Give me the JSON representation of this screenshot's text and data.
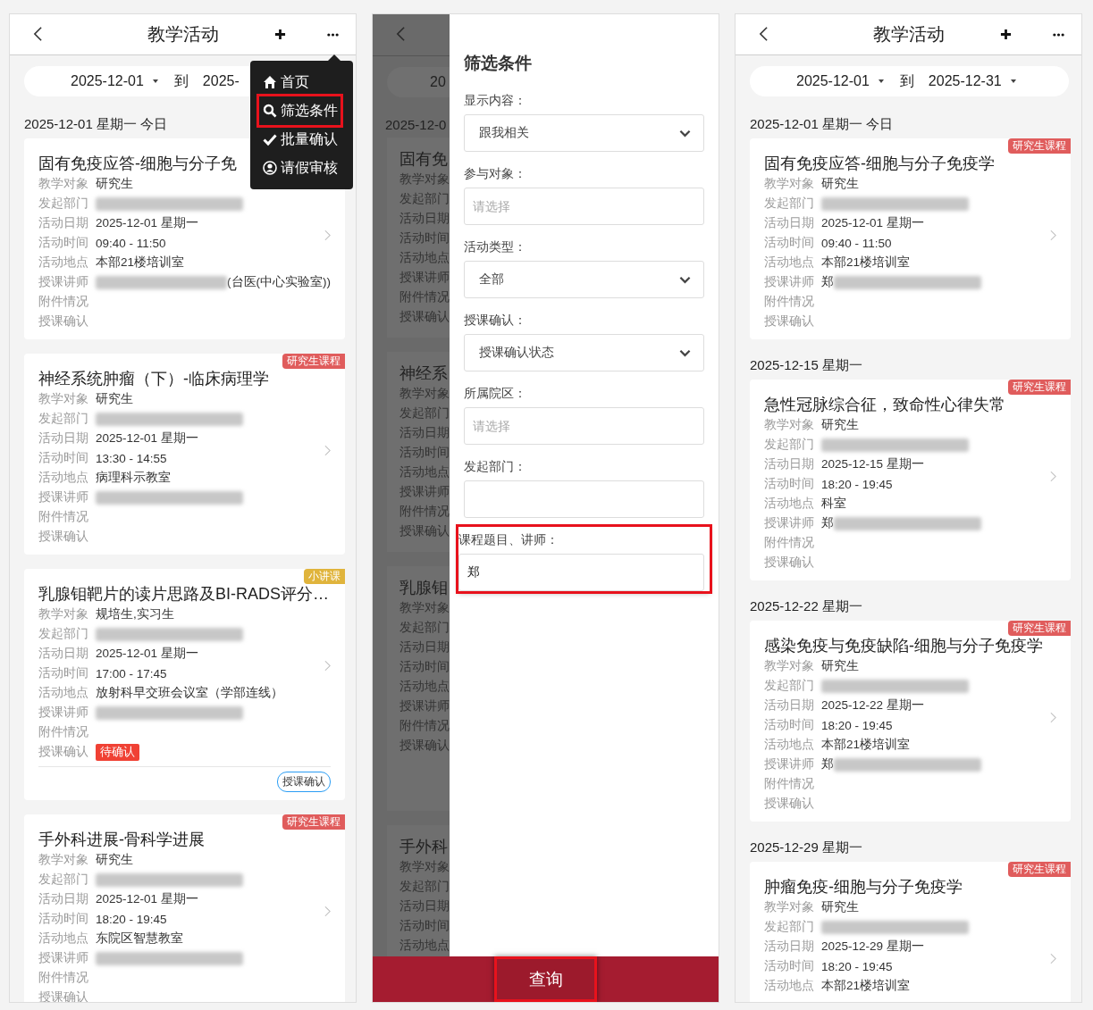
{
  "panels": [
    {
      "kind": "list",
      "title": "教学活动",
      "date_range": {
        "start": "2025-12-01",
        "separator": "到",
        "end": "2025-",
        "end_caret": false
      },
      "sections": [
        {
          "date": "2025-12-01 星期一 今日",
          "cards": [
            {
              "title": "固有免疫应答-细胞与分子免",
              "rows": [
                {
                  "label": "教学对象",
                  "value": "研究生"
                },
                {
                  "label": "发起部门",
                  "redacted": true
                },
                {
                  "label": "活动日期",
                  "value": "2025-12-01 星期一"
                },
                {
                  "label": "活动时间",
                  "value": "09:40 - 11:50"
                },
                {
                  "label": "活动地点",
                  "value": "本部21楼培训室"
                },
                {
                  "label": "授课讲师",
                  "value": "(台医(中心实验室))",
                  "redacted_before": true
                },
                {
                  "label": "附件情况"
                },
                {
                  "label": "授课确认"
                }
              ]
            },
            {
              "title": "神经系统肿瘤（下）-临床病理学",
              "tag": {
                "text": "研究生课程",
                "color": "#e05c5c"
              },
              "rows": [
                {
                  "label": "教学对象",
                  "value": "研究生"
                },
                {
                  "label": "发起部门",
                  "redacted": true
                },
                {
                  "label": "活动日期",
                  "value": "2025-12-01 星期一"
                },
                {
                  "label": "活动时间",
                  "value": "13:30 - 14:55"
                },
                {
                  "label": "活动地点",
                  "value": "病理科示教室"
                },
                {
                  "label": "授课讲师",
                  "redacted": true
                },
                {
                  "label": "附件情况"
                },
                {
                  "label": "授课确认"
                }
              ]
            },
            {
              "title": "乳腺钼靶片的读片思路及BI-RADS评分…",
              "tag": {
                "text": "小讲课",
                "color": "#e0b43c"
              },
              "rows": [
                {
                  "label": "教学对象",
                  "value": "规培生,实习生"
                },
                {
                  "label": "发起部门",
                  "redacted": true
                },
                {
                  "label": "活动日期",
                  "value": "2025-12-01 星期一"
                },
                {
                  "label": "活动时间",
                  "value": "17:00 - 17:45"
                },
                {
                  "label": "活动地点",
                  "value": "放射科早交班会议室（学部连线）"
                },
                {
                  "label": "授课讲师",
                  "redacted": true
                },
                {
                  "label": "附件情况"
                },
                {
                  "label": "授课确认",
                  "status": "待确认"
                }
              ],
              "footer_button": "授课确认"
            },
            {
              "title": "手外科进展-骨科学进展",
              "tag": {
                "text": "研究生课程",
                "color": "#e05c5c"
              },
              "rows": [
                {
                  "label": "教学对象",
                  "value": "研究生"
                },
                {
                  "label": "发起部门",
                  "redacted": true
                },
                {
                  "label": "活动日期",
                  "value": "2025-12-01 星期一"
                },
                {
                  "label": "活动时间",
                  "value": "18:20 - 19:45"
                },
                {
                  "label": "活动地点",
                  "value": "东院区智慧教室"
                },
                {
                  "label": "授课讲师",
                  "redacted": true
                },
                {
                  "label": "附件情况"
                },
                {
                  "label": "授课确认"
                }
              ]
            }
          ]
        }
      ],
      "menu": {
        "items": [
          {
            "kind": "home",
            "label": "首页",
            "highlighted": false
          },
          {
            "kind": "search",
            "label": "筛选条件",
            "highlighted": true
          },
          {
            "kind": "check",
            "label": "批量确认",
            "highlighted": false
          },
          {
            "kind": "user",
            "label": "请假审核",
            "highlighted": false
          }
        ]
      }
    },
    {
      "kind": "filter",
      "background": {
        "date_range": "20",
        "section": "2025-12-0",
        "cards": [
          {
            "title": "固有免",
            "labels": [
              "教学对象",
              "发起部门",
              "活动日期",
              "活动时间",
              "活动地点",
              "授课讲师",
              "附件情况",
              "授课确认"
            ]
          },
          {
            "title": "神经系",
            "labels": [
              "教学对象",
              "发起部门",
              "活动日期",
              "活动时间",
              "活动地点",
              "授课讲师",
              "附件情况",
              "授课确认"
            ]
          },
          {
            "title": "乳腺钼",
            "labels": [
              "教学对象",
              "发起部门",
              "活动日期",
              "活动时间",
              "活动地点",
              "授课讲师",
              "附件情况",
              "授课确认"
            ]
          },
          {
            "title": "手外科",
            "labels": [
              "教学对象",
              "发起部门",
              "活动日期",
              "活动时间",
              "活动地点"
            ]
          }
        ]
      },
      "drawer": {
        "title": "筛选条件",
        "fields": [
          {
            "label": "显示内容：",
            "kind": "select",
            "value": "跟我相关",
            "highlighted": false
          },
          {
            "label": "参与对象：",
            "kind": "input",
            "placeholder": "请选择",
            "highlighted": false
          },
          {
            "label": "活动类型：",
            "kind": "select",
            "value": "全部",
            "highlighted": false
          },
          {
            "label": "授课确认：",
            "kind": "select",
            "value": "授课确认状态",
            "highlighted": false
          },
          {
            "label": "所属院区：",
            "kind": "input",
            "placeholder": "请选择",
            "highlighted": false
          },
          {
            "label": "发起部门：",
            "kind": "input",
            "highlighted": false
          },
          {
            "label": "课程题目、讲师：",
            "kind": "input",
            "value": "郑",
            "highlighted": true
          }
        ],
        "submit": {
          "label": "查询",
          "highlighted": true
        }
      }
    },
    {
      "kind": "list",
      "title": "教学活动",
      "date_range": {
        "start": "2025-12-01",
        "separator": "到",
        "end": "2025-12-31",
        "end_caret": true
      },
      "sections": [
        {
          "date": "2025-12-01 星期一 今日",
          "cards": [
            {
              "title": "固有免疫应答-细胞与分子免疫学",
              "tag": {
                "text": "研究生课程",
                "color": "#e05c5c"
              },
              "rows": [
                {
                  "label": "教学对象",
                  "value": "研究生"
                },
                {
                  "label": "发起部门",
                  "redacted": true
                },
                {
                  "label": "活动日期",
                  "value": "2025-12-01 星期一"
                },
                {
                  "label": "活动时间",
                  "value": "09:40 - 11:50"
                },
                {
                  "label": "活动地点",
                  "value": "本部21楼培训室"
                },
                {
                  "label": "授课讲师",
                  "value": "郑",
                  "redacted": true
                },
                {
                  "label": "附件情况"
                },
                {
                  "label": "授课确认"
                }
              ]
            }
          ]
        },
        {
          "date": "2025-12-15 星期一",
          "cards": [
            {
              "title": "急性冠脉综合征，致命性心律失常",
              "tag": {
                "text": "研究生课程",
                "color": "#e05c5c"
              },
              "rows": [
                {
                  "label": "教学对象",
                  "value": "研究生"
                },
                {
                  "label": "发起部门",
                  "redacted": true
                },
                {
                  "label": "活动日期",
                  "value": "2025-12-15 星期一"
                },
                {
                  "label": "活动时间",
                  "value": "18:20 - 19:45"
                },
                {
                  "label": "活动地点",
                  "value": "科室"
                },
                {
                  "label": "授课讲师",
                  "value": "郑",
                  "redacted": true
                },
                {
                  "label": "附件情况"
                },
                {
                  "label": "授课确认"
                }
              ]
            }
          ]
        },
        {
          "date": "2025-12-22 星期一",
          "cards": [
            {
              "title": "感染免疫与免疫缺陷-细胞与分子免疫学",
              "tag": {
                "text": "研究生课程",
                "color": "#e05c5c"
              },
              "rows": [
                {
                  "label": "教学对象",
                  "value": "研究生"
                },
                {
                  "label": "发起部门",
                  "redacted": true
                },
                {
                  "label": "活动日期",
                  "value": "2025-12-22 星期一"
                },
                {
                  "label": "活动时间",
                  "value": "18:20 - 19:45"
                },
                {
                  "label": "活动地点",
                  "value": "本部21楼培训室"
                },
                {
                  "label": "授课讲师",
                  "value": "郑",
                  "redacted": true
                },
                {
                  "label": "附件情况"
                },
                {
                  "label": "授课确认"
                }
              ]
            }
          ]
        },
        {
          "date": "2025-12-29 星期一",
          "cards": [
            {
              "title": "肿瘤免疫-细胞与分子免疫学",
              "tag": {
                "text": "研究生课程",
                "color": "#e05c5c"
              },
              "rows": [
                {
                  "label": "教学对象",
                  "value": "研究生"
                },
                {
                  "label": "发起部门",
                  "redacted": true
                },
                {
                  "label": "活动日期",
                  "value": "2025-12-29 星期一"
                },
                {
                  "label": "活动时间",
                  "value": "18:20 - 19:45"
                },
                {
                  "label": "活动地点",
                  "value": "本部21楼培训室"
                }
              ]
            }
          ]
        }
      ]
    }
  ]
}
